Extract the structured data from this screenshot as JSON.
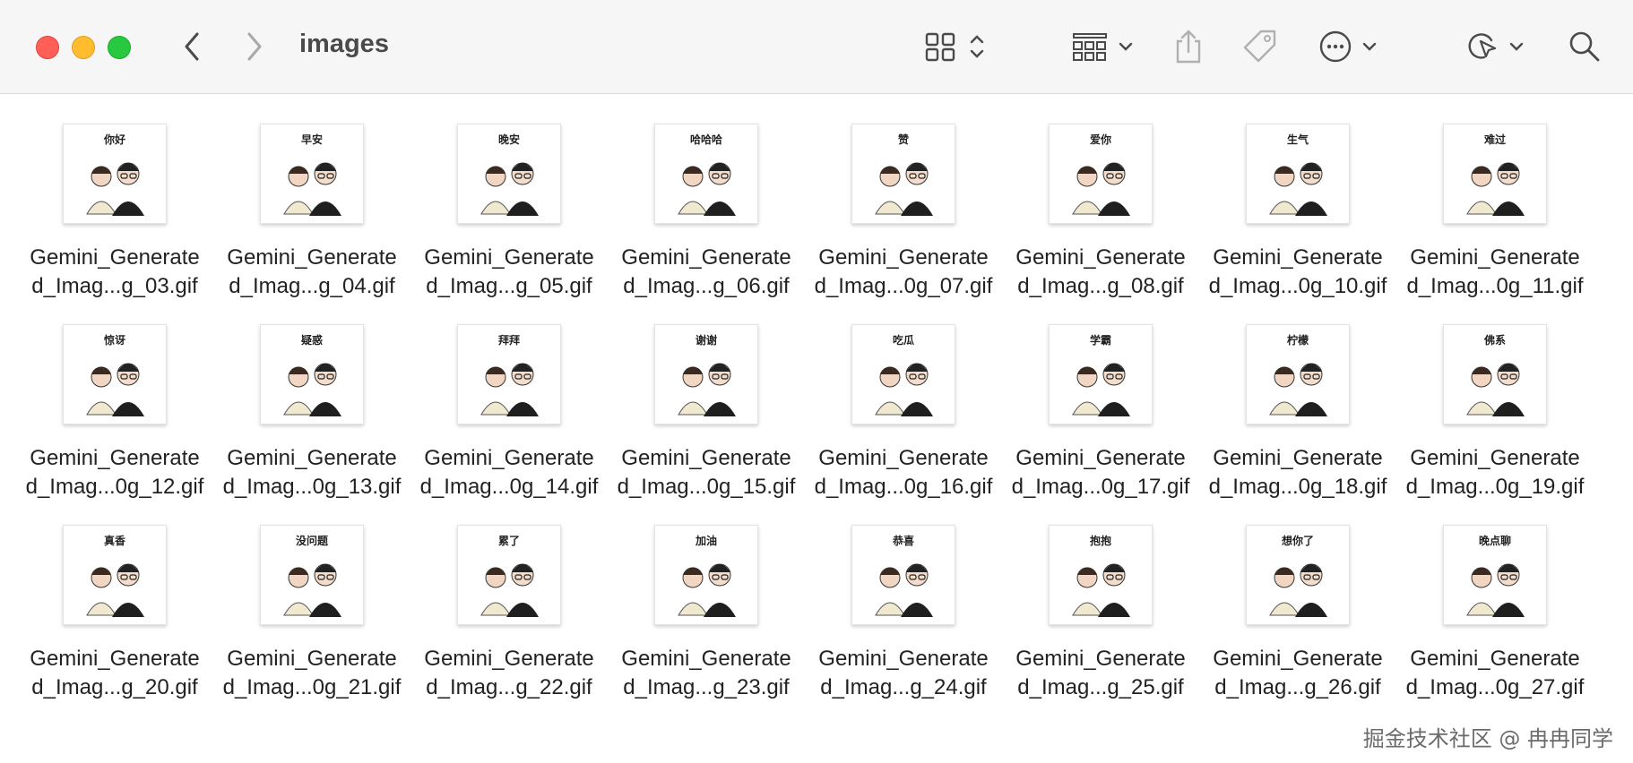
{
  "window": {
    "title": "images"
  },
  "toolbar": {
    "buttons": [
      {
        "name": "back-icon"
      },
      {
        "name": "forward-icon"
      },
      {
        "name": "grid-view-icon"
      },
      {
        "name": "group-icon"
      },
      {
        "name": "share-icon"
      },
      {
        "name": "tag-icon"
      },
      {
        "name": "more-icon"
      },
      {
        "name": "markup-icon"
      },
      {
        "name": "search-icon"
      }
    ]
  },
  "files": [
    {
      "sticker": "你好",
      "name_line1": "Gemini_Generate",
      "name_line2": "d_Imag...g_03.gif"
    },
    {
      "sticker": "早安",
      "name_line1": "Gemini_Generate",
      "name_line2": "d_Imag...g_04.gif"
    },
    {
      "sticker": "晚安",
      "name_line1": "Gemini_Generate",
      "name_line2": "d_Imag...g_05.gif"
    },
    {
      "sticker": "哈哈哈",
      "name_line1": "Gemini_Generate",
      "name_line2": "d_Imag...g_06.gif"
    },
    {
      "sticker": "赞",
      "name_line1": "Gemini_Generate",
      "name_line2": "d_Imag...0g_07.gif"
    },
    {
      "sticker": "爱你",
      "name_line1": "Gemini_Generate",
      "name_line2": "d_Imag...g_08.gif"
    },
    {
      "sticker": "生气",
      "name_line1": "Gemini_Generate",
      "name_line2": "d_Imag...0g_10.gif"
    },
    {
      "sticker": "难过",
      "name_line1": "Gemini_Generate",
      "name_line2": "d_Imag...0g_11.gif"
    },
    {
      "sticker": "惊讶",
      "name_line1": "Gemini_Generate",
      "name_line2": "d_Imag...0g_12.gif"
    },
    {
      "sticker": "疑惑",
      "name_line1": "Gemini_Generate",
      "name_line2": "d_Imag...0g_13.gif"
    },
    {
      "sticker": "拜拜",
      "name_line1": "Gemini_Generate",
      "name_line2": "d_Imag...0g_14.gif"
    },
    {
      "sticker": "谢谢",
      "name_line1": "Gemini_Generate",
      "name_line2": "d_Imag...0g_15.gif"
    },
    {
      "sticker": "吃瓜",
      "name_line1": "Gemini_Generate",
      "name_line2": "d_Imag...0g_16.gif"
    },
    {
      "sticker": "学霸",
      "name_line1": "Gemini_Generate",
      "name_line2": "d_Imag...0g_17.gif"
    },
    {
      "sticker": "柠檬",
      "name_line1": "Gemini_Generate",
      "name_line2": "d_Imag...0g_18.gif"
    },
    {
      "sticker": "佛系",
      "name_line1": "Gemini_Generate",
      "name_line2": "d_Imag...0g_19.gif"
    },
    {
      "sticker": "真香",
      "name_line1": "Gemini_Generate",
      "name_line2": "d_Imag...g_20.gif"
    },
    {
      "sticker": "没问题",
      "name_line1": "Gemini_Generate",
      "name_line2": "d_Imag...0g_21.gif"
    },
    {
      "sticker": "累了",
      "name_line1": "Gemini_Generate",
      "name_line2": "d_Imag...g_22.gif"
    },
    {
      "sticker": "加油",
      "name_line1": "Gemini_Generate",
      "name_line2": "d_Imag...g_23.gif"
    },
    {
      "sticker": "恭喜",
      "name_line1": "Gemini_Generate",
      "name_line2": "d_Imag...g_24.gif"
    },
    {
      "sticker": "抱抱",
      "name_line1": "Gemini_Generate",
      "name_line2": "d_Imag...g_25.gif"
    },
    {
      "sticker": "想你了",
      "name_line1": "Gemini_Generate",
      "name_line2": "d_Imag...g_26.gif"
    },
    {
      "sticker": "晚点聊",
      "name_line1": "Gemini_Generate",
      "name_line2": "d_Imag...0g_27.gif"
    }
  ],
  "watermark": "掘金技术社区 @ 冉冉同学"
}
